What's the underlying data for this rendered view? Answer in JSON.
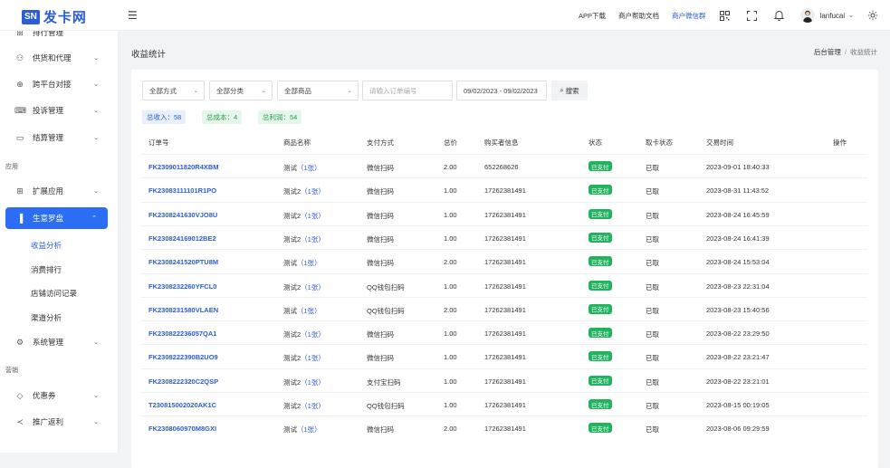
{
  "header": {
    "logo_box": "SN",
    "logo_text": "发卡网",
    "links": [
      "APP下载",
      "商户帮助文档",
      "商户微信群"
    ],
    "username": "lanfucai",
    "menu_icon": "hamburger-icon"
  },
  "sidebar": {
    "items": [
      {
        "label": "排行管理",
        "icon": "ranking-icon"
      },
      {
        "label": "供货和代理",
        "icon": "supplier-icon"
      },
      {
        "label": "跨平台对接",
        "icon": "globe-icon"
      },
      {
        "label": "投诉管理",
        "icon": "complaint-icon"
      },
      {
        "label": "结算管理",
        "icon": "wallet-icon"
      }
    ],
    "section_app": "应用",
    "app_items": [
      {
        "label": "扩展应用",
        "icon": "apps-icon"
      },
      {
        "label": "生意罗盘",
        "icon": "chart-icon"
      }
    ],
    "sub_items": [
      "收益分析",
      "消费排行",
      "店铺访问记录",
      "渠道分析"
    ],
    "system_item": {
      "label": "系统管理",
      "icon": "settings-icon"
    },
    "section_marketing": "营销",
    "marketing_items": [
      {
        "label": "优惠券",
        "icon": "coupon-icon"
      },
      {
        "label": "推广返利",
        "icon": "share-icon"
      }
    ]
  },
  "page": {
    "title": "收益统计",
    "breadcrumb": [
      "后台管理",
      "收益统计"
    ]
  },
  "filters": {
    "pay_method": "全部方式",
    "category": "全部分类",
    "product": "全部商品",
    "order_placeholder": "请输入订单编号",
    "date_range": "09/02/2023 - 09/02/2023",
    "search_label": "搜索"
  },
  "stats": {
    "income": "总收入：58",
    "cost": "总成本：4",
    "profit": "总利润：54"
  },
  "table": {
    "headers": [
      "订单号",
      "商品名称",
      "支付方式",
      "总价",
      "购买者信息",
      "状态",
      "取卡状态",
      "交易时间",
      "操作"
    ],
    "rows": [
      {
        "order": "FK2309011820R4XBM",
        "product": "测试",
        "qty": "（1张）",
        "pay": "微信扫码",
        "price": "2.00",
        "buyer": "652268626",
        "status": "已支付",
        "pickup": "已取",
        "time": "2023-09-01 18:40:33"
      },
      {
        "order": "FK23083111101R1PO",
        "product": "测试2",
        "qty": "（1张）",
        "pay": "微信扫码",
        "price": "1.00",
        "buyer": "17262381491",
        "status": "已支付",
        "pickup": "已取",
        "time": "2023-08-31 11:43:52"
      },
      {
        "order": "FK2308241630VJO8U",
        "product": "测试2",
        "qty": "（1张）",
        "pay": "微信扫码",
        "price": "1.00",
        "buyer": "17262381491",
        "status": "已支付",
        "pickup": "已取",
        "time": "2023-08-24 16:45:59"
      },
      {
        "order": "FK230824169012BE2",
        "product": "测试2",
        "qty": "（1张）",
        "pay": "微信扫码",
        "price": "1.00",
        "buyer": "17262381491",
        "status": "已支付",
        "pickup": "已取",
        "time": "2023-08-24 16:41:39"
      },
      {
        "order": "FK2308241520PTU8M",
        "product": "测试",
        "qty": "（1张）",
        "pay": "微信扫码",
        "price": "2.00",
        "buyer": "17262381491",
        "status": "已支付",
        "pickup": "已取",
        "time": "2023-08-24 15:53:04"
      },
      {
        "order": "FK2308232260YFCL0",
        "product": "测试2",
        "qty": "（1张）",
        "pay": "QQ钱包扫码",
        "price": "1.00",
        "buyer": "17262381491",
        "status": "已支付",
        "pickup": "已取",
        "time": "2023-08-23 22:31:04"
      },
      {
        "order": "FK2308231580VLAEN",
        "product": "测试",
        "qty": "（1张）",
        "pay": "QQ钱包扫码",
        "price": "2.00",
        "buyer": "17262381491",
        "status": "已支付",
        "pickup": "已取",
        "time": "2023-08-23 15:40:56"
      },
      {
        "order": "FK230822236057QA1",
        "product": "测试2",
        "qty": "（1张）",
        "pay": "微信扫码",
        "price": "1.00",
        "buyer": "17262381491",
        "status": "已支付",
        "pickup": "已取",
        "time": "2023-08-22 23:29:50"
      },
      {
        "order": "FK2308222390B2UO9",
        "product": "测试2",
        "qty": "（1张）",
        "pay": "微信扫码",
        "price": "1.00",
        "buyer": "17262381491",
        "status": "已支付",
        "pickup": "已取",
        "time": "2023-08-22 23:21:47"
      },
      {
        "order": "FK2308222320C2QSP",
        "product": "测试2",
        "qty": "（1张）",
        "pay": "支付宝扫码",
        "price": "1.00",
        "buyer": "17262381491",
        "status": "已支付",
        "pickup": "已取",
        "time": "2023-08-22 23:21:01"
      },
      {
        "order": "T230815002020AK1C",
        "product": "测试2",
        "qty": "（1张）",
        "pay": "QQ钱包扫码",
        "price": "1.00",
        "buyer": "17262381491",
        "status": "已支付",
        "pickup": "已取",
        "time": "2023-08-15 00:19:05"
      },
      {
        "order": "FK2308060970M8GXI",
        "product": "测试",
        "qty": "（1张）",
        "pay": "微信扫码",
        "price": "2.00",
        "buyer": "17262381491",
        "status": "已支付",
        "pickup": "已取",
        "time": "2023-08-06 09:29:59"
      }
    ]
  },
  "colors": {
    "accent": "#2b5cd9",
    "sidebar_active": "#2b6ef5",
    "paid_badge": "#22b35e"
  }
}
